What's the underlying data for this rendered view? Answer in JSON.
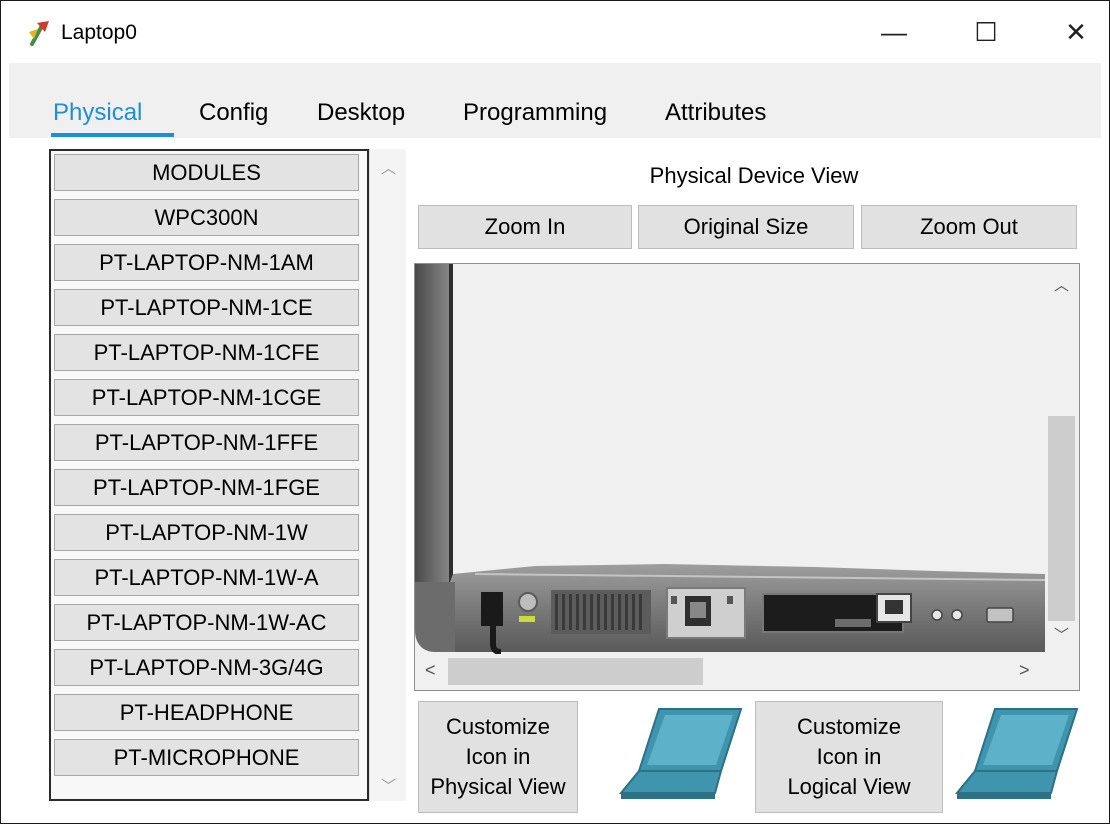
{
  "window": {
    "title": "Laptop0",
    "controls": {
      "minimize": "—",
      "maximize": "☐",
      "close": "✕"
    }
  },
  "tabs": [
    {
      "label": "Physical",
      "active": true
    },
    {
      "label": "Config",
      "active": false
    },
    {
      "label": "Desktop",
      "active": false
    },
    {
      "label": "Programming",
      "active": false
    },
    {
      "label": "Attributes",
      "active": false
    }
  ],
  "modules": {
    "items": [
      "MODULES",
      "WPC300N",
      "PT-LAPTOP-NM-1AM",
      "PT-LAPTOP-NM-1CE",
      "PT-LAPTOP-NM-1CFE",
      "PT-LAPTOP-NM-1CGE",
      "PT-LAPTOP-NM-1FFE",
      "PT-LAPTOP-NM-1FGE",
      "PT-LAPTOP-NM-1W",
      "PT-LAPTOP-NM-1W-A",
      "PT-LAPTOP-NM-1W-AC",
      "PT-LAPTOP-NM-3G/4G",
      "PT-HEADPHONE",
      "PT-MICROPHONE"
    ]
  },
  "physical_view": {
    "title": "Physical Device View",
    "zoom_in": "Zoom In",
    "original_size": "Original Size",
    "zoom_out": "Zoom Out"
  },
  "customize": {
    "physical": {
      "line1": "Customize",
      "line2": "Icon in",
      "line3": "Physical View"
    },
    "logical": {
      "line1": "Customize",
      "line2": "Icon in",
      "line3": "Logical View"
    }
  },
  "colors": {
    "accent": "#1c8fd8",
    "laptop_icon": "#3f95ae",
    "button_bg": "#e1e1e1"
  },
  "icons": {
    "app": "packet-tracer-icon",
    "laptop": "laptop-icon"
  }
}
